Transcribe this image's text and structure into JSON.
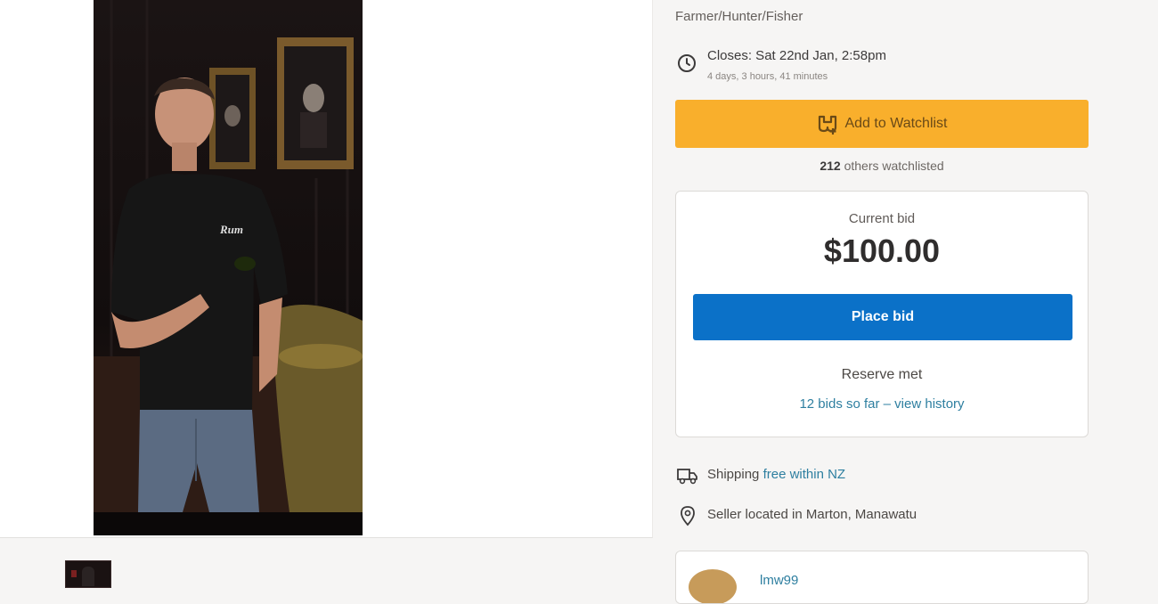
{
  "listing": {
    "category": "Farmer/Hunter/Fisher",
    "closes": "Closes: Sat 22nd Jan, 2:58pm",
    "countdown": "4 days, 3 hours, 41 minutes"
  },
  "watchlist": {
    "button_label": "Add to Watchlist",
    "count": "212",
    "count_suffix": " others watchlisted"
  },
  "bid": {
    "label": "Current bid",
    "amount": "$100.00",
    "button_label": "Place bid",
    "reserve_status": "Reserve met",
    "history_link": "12 bids so far – view history"
  },
  "shipping": {
    "label": "Shipping ",
    "value": "free within NZ"
  },
  "location": {
    "text": "Seller located in Marton, Manawatu"
  },
  "seller": {
    "name": "lmw99"
  },
  "colors": {
    "watchlist_button": "#f9af2c",
    "bid_button": "#0b71c8",
    "link": "#2e7fa0"
  },
  "icons": {
    "closes": "clock-icon",
    "watchlist": "binoculars-plus-icon",
    "shipping": "truck-icon",
    "location": "map-pin-icon"
  }
}
